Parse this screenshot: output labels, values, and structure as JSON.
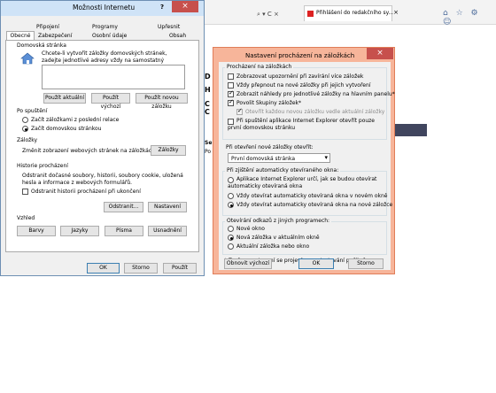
{
  "browser": {
    "address_icons": "⌕ ▾ C ×",
    "tab_label": "Přihlášení do redakčního sy...",
    "tab_close": "×",
    "toolbar_icons": "⌂ ☆ ⚙ ☺",
    "page_left_letters": [
      "D",
      "H",
      "C",
      "C"
    ],
    "page_left_bottom": [
      "Se",
      "Po"
    ]
  },
  "inet": {
    "title": "Možnosti Internetu",
    "help": "?",
    "close": "×",
    "tabs_row1": [
      "Připojení",
      "Programy",
      "Upřesnit"
    ],
    "tabs_row2": [
      "Obecné",
      "Zabezpečení",
      "Osobní údaje",
      "Obsah"
    ],
    "home_group": "Domovská stránka",
    "home_desc": "Chcete-li vytvořit záložky domovských stránek, zadejte jednotlivé adresy vždy na samostatný řádek.",
    "home_buttons": [
      "Použít aktuální",
      "Použít výchozí",
      "Použít novou záložku"
    ],
    "startup_group": "Po spuštění",
    "startup_options": [
      "Začít záložkami z poslední relace",
      "Začít domovskou stránkou"
    ],
    "tabs_group": "Záložky",
    "tabs_desc": "Změnit zobrazení webových stránek na záložkách.",
    "tabs_button": "Záložky",
    "history_group": "Historie procházení",
    "history_desc": "Odstranit dočasné soubory, historii, soubory cookie, uložená hesla a informace z webových formulářů.",
    "history_checkbox": "Odstranit historii procházení při ukončení",
    "history_buttons": [
      "Odstranit...",
      "Nastavení"
    ],
    "look_group": "Vzhled",
    "look_buttons": [
      "Barvy",
      "Jazyky",
      "Písma",
      "Usnadnění"
    ],
    "footer_buttons": [
      "OK",
      "Storno",
      "Použít"
    ]
  },
  "tabset": {
    "title": "Nastavení procházení na záložkách",
    "close": "×",
    "tabbed_group": "Procházení na záložkách",
    "checkboxes": [
      {
        "label": "Zobrazovat upozornění při zavírání více záložek",
        "checked": false
      },
      {
        "label": "Vždy přepnout na nové záložky při jejich vytvoření",
        "checked": false
      },
      {
        "label": "Zobrazit náhledy pro jednotlivé záložky na hlavním panelu*",
        "checked": true
      },
      {
        "label": "Povolit Skupiny záložek*",
        "checked": true
      },
      {
        "label": "Otevřít každou novou záložku vedle aktuální záložky",
        "checked": true,
        "disabled": true
      },
      {
        "label": "Při spuštění aplikace Internet Explorer otevřít pouze první domovskou stránku",
        "checked": false
      }
    ],
    "newtab_label": "Při otevření nové záložky otevřít:",
    "newtab_value": "První domovská stránka",
    "popup_group": "Při zjištění automaticky otevíraného okna:",
    "popup_options": [
      "Aplikace Internet Explorer určí, jak se budou otevírat automaticky otevíraná okna",
      "Vždy otevírat automaticky otevíraná okna v novém okně",
      "Vždy otevírat automaticky otevíraná okna na nové záložce"
    ],
    "popup_selected": 2,
    "links_group": "Otevírání odkazů z jiných programech:",
    "links_options": [
      "Nové okno",
      "Nová záložka v aktuálním okně",
      "Aktuální záložka nebo okno"
    ],
    "links_selected": 1,
    "note": "* Změna nastavení se projeví po restartování počítače.",
    "buttons": [
      "Obnovit výchozí",
      "OK",
      "Storno"
    ]
  }
}
